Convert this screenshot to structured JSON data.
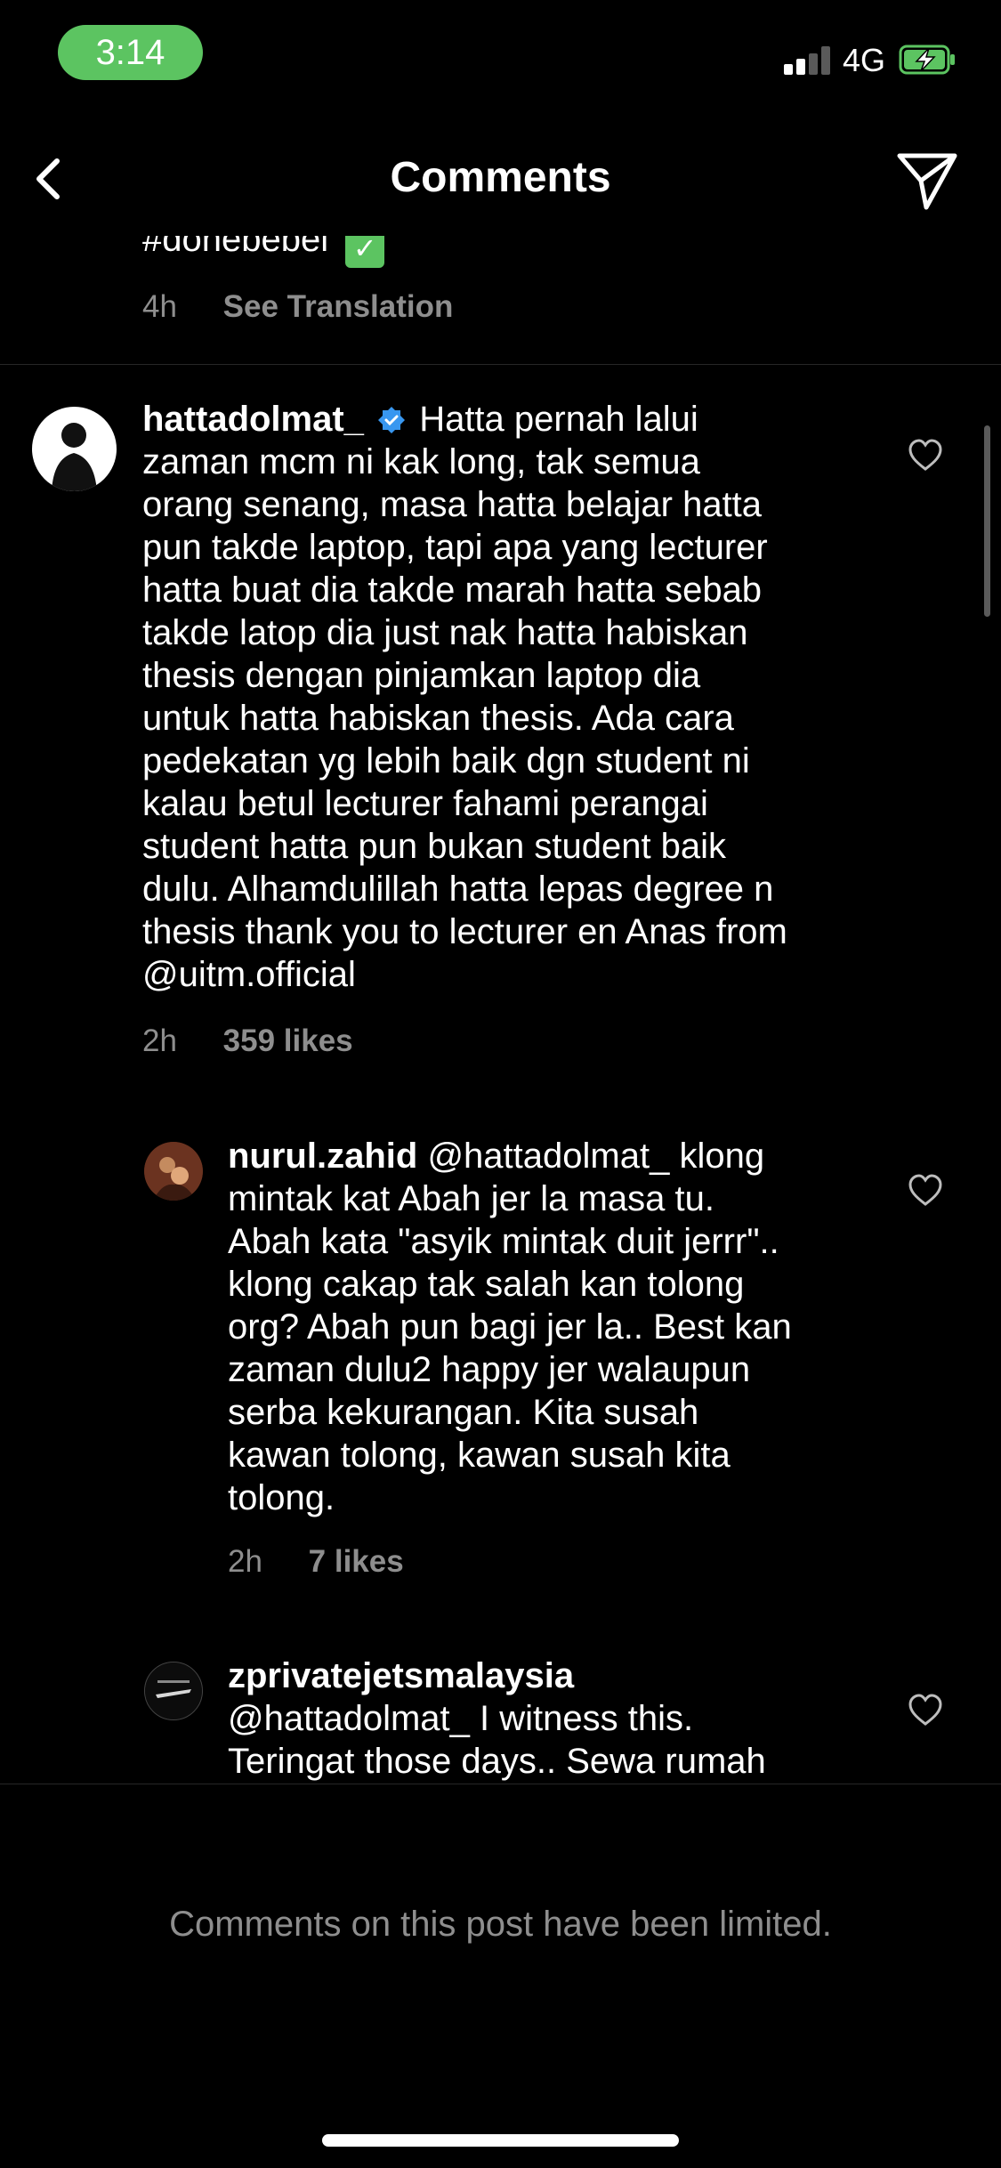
{
  "status_bar": {
    "time": "3:14",
    "network": "4G",
    "signal_icon": "signal-bars-icon",
    "battery_icon": "battery-charging-icon",
    "battery_color": "#5cc461"
  },
  "header": {
    "title": "Comments",
    "back_icon": "chevron-left-icon",
    "send_icon": "paper-plane-icon"
  },
  "previous_comment": {
    "text_fragment": "#donebebel",
    "emoji": "✅",
    "time": "4h",
    "translate_label": "See Translation"
  },
  "comments": [
    {
      "username": "hattadolmat_",
      "verified": true,
      "lines": [
        "Hatta pernah lalui",
        "zaman mcm ni kak long, tak semua",
        "orang senang, masa hatta belajar hatta",
        "pun takde laptop, tapi apa yang lecturer",
        "hatta buat dia takde marah hatta sebab",
        "takde latop dia just nak hatta habiskan",
        "thesis dengan pinjamkan laptop dia",
        "untuk hatta habiskan thesis. Ada cara",
        "pedekatan yg lebih baik dgn student ni",
        "kalau betul lecturer fahami perangai",
        "student hatta pun bukan student baik",
        "dulu. Alhamdulillah hatta lepas degree n",
        "thesis thank you to lecturer en Anas from",
        "@uitm.official"
      ],
      "time": "2h",
      "likes": "359 likes"
    },
    {
      "username": "nurul.zahid",
      "lines": [
        "@hattadolmat_ klong",
        "mintak kat Abah jer la masa tu.",
        "Abah kata \"asyik mintak duit jerrr\"..",
        "klong cakap tak salah kan tolong",
        "org? Abah pun bagi jer la.. Best kan",
        "zaman dulu2 happy jer walaupun",
        "serba kekurangan. Kita susah",
        "kawan tolong, kawan susah kita",
        "tolong."
      ],
      "time": "2h",
      "likes": "7 likes"
    },
    {
      "username": "zprivatejetsmalaysia",
      "lines": [
        "@hattadolmat_ I witness this.",
        "Teringat those days.. Sewa rumah"
      ]
    }
  ],
  "footer": {
    "limited_text": "Comments on this post have been limited."
  }
}
